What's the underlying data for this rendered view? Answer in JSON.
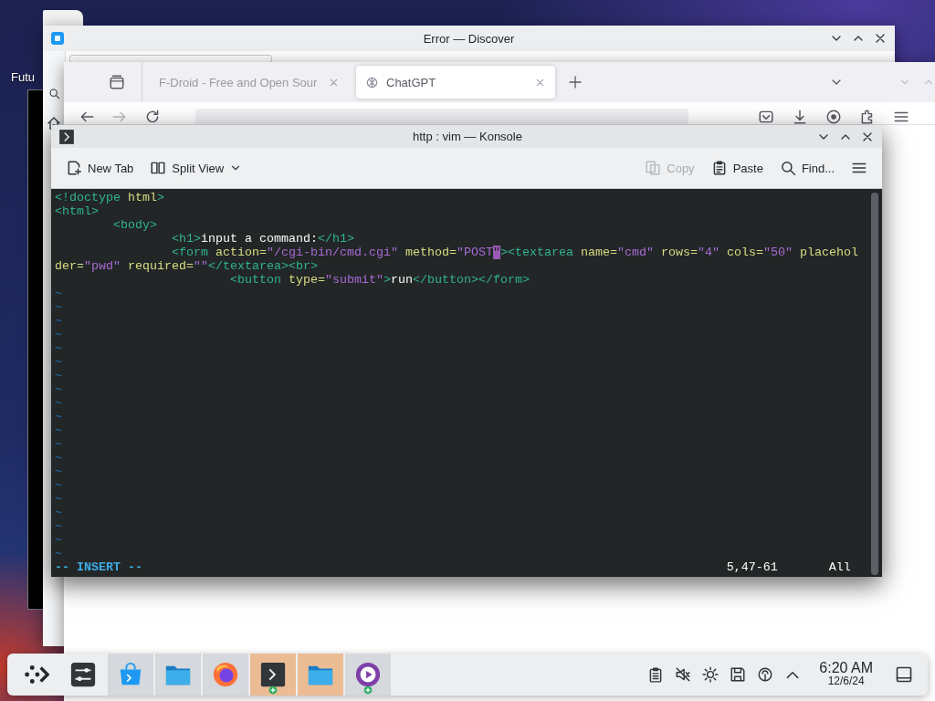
{
  "desktop": {
    "icon_label": "Futu"
  },
  "discover_window": {
    "title": "Error — Discover"
  },
  "browser": {
    "tabs": [
      {
        "label": "F-Droid - Free and Open Sour",
        "selected": false,
        "kind": "none"
      },
      {
        "label": "ChatGPT",
        "selected": true,
        "kind": "knot"
      }
    ]
  },
  "konsole": {
    "title": "http : vim — Konsole",
    "toolbar": [
      {
        "kind": "new-tab",
        "label": "New Tab",
        "disabled": false
      },
      {
        "kind": "split-view",
        "label": "Split View",
        "disabled": false
      },
      {
        "kind": "copy",
        "label": "Copy",
        "disabled": true
      },
      {
        "kind": "paste",
        "label": "Paste",
        "disabled": false
      },
      {
        "kind": "find",
        "label": "Find...",
        "disabled": false
      },
      {
        "kind": "menu",
        "disabled": false
      }
    ],
    "lines": [
      {
        "text": "<!doctype html>"
      },
      {
        "text": "<html>"
      },
      {
        "text": "\t<body>"
      },
      {
        "text": "\t\t<h1>input a command:</h1>"
      },
      {
        "before": "\t\t<form action=\"/cgi-bin/cmd.cgi\" method=\"POST",
        "cursor": "\"",
        "after": "><textarea name=\"cmd\" rows=\"4\" cols=\"50\" placehol"
      },
      {
        "text": "der=\"pwd\" required=\"\"</textarea><br>"
      },
      {
        "text": "\t\t\t<button type=\"submit\">run</button></form>"
      }
    ],
    "filler": [
      "~",
      "~",
      "~",
      "~",
      "~",
      "~",
      "~",
      "~",
      "~",
      "~",
      "~",
      "~",
      "~",
      "~",
      "~",
      "~",
      "~",
      "~",
      "~",
      "~"
    ],
    "mode": "-- INSERT --",
    "position": "5,47-61",
    "scroll": "All"
  },
  "taskbar": {
    "items": [
      {
        "kind": "launcher",
        "open": false,
        "active": false,
        "badge": false
      },
      {
        "kind": "settings",
        "open": false,
        "active": false,
        "badge": false
      },
      {
        "kind": "store",
        "open": true,
        "active": false,
        "badge": false
      },
      {
        "kind": "folder",
        "open": true,
        "active": false,
        "badge": false
      },
      {
        "kind": "browser",
        "open": true,
        "active": false,
        "badge": false
      },
      {
        "kind": "terminal",
        "open": true,
        "active": true,
        "badge": true
      },
      {
        "kind": "folder",
        "open": true,
        "active": true,
        "badge": false
      },
      {
        "kind": "media",
        "open": true,
        "active": false,
        "badge": true
      }
    ],
    "tray": [
      {
        "kind": "clipboard"
      },
      {
        "kind": "muted"
      },
      {
        "kind": "sun"
      },
      {
        "kind": "disk"
      },
      {
        "kind": "gauge"
      },
      {
        "kind": "caret"
      }
    ],
    "clock": {
      "time": "6:20 AM",
      "date": "12/6/24"
    }
  }
}
